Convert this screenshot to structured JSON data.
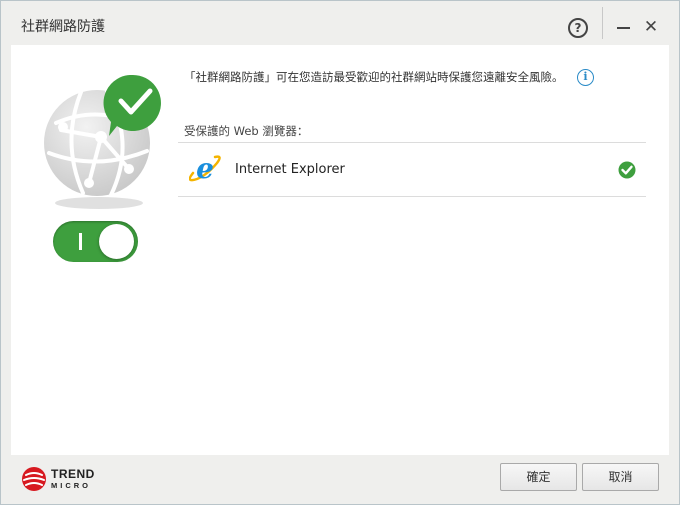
{
  "window": {
    "title": "社群網路防護"
  },
  "titlebar": {
    "help_glyph": "?",
    "close_glyph": "✕"
  },
  "main": {
    "description": "「社群網路防護」可在您造訪最受歡迎的社群網站時保護您遠離安全風險。",
    "info_glyph": "i",
    "toggle": {
      "state": "on",
      "on_mark": "I"
    },
    "browsers_label": "受保護的 Web 瀏覽器：",
    "browsers": [
      {
        "name": "Internet Explorer",
        "protected": true
      }
    ]
  },
  "footer": {
    "logo_line1": "TREND",
    "logo_line2": "MICRO",
    "ok_label": "確定",
    "cancel_label": "取消"
  },
  "colors": {
    "accent_green": "#3e9f3e",
    "info_blue": "#2a8bc7",
    "logo_red": "#d71920"
  }
}
